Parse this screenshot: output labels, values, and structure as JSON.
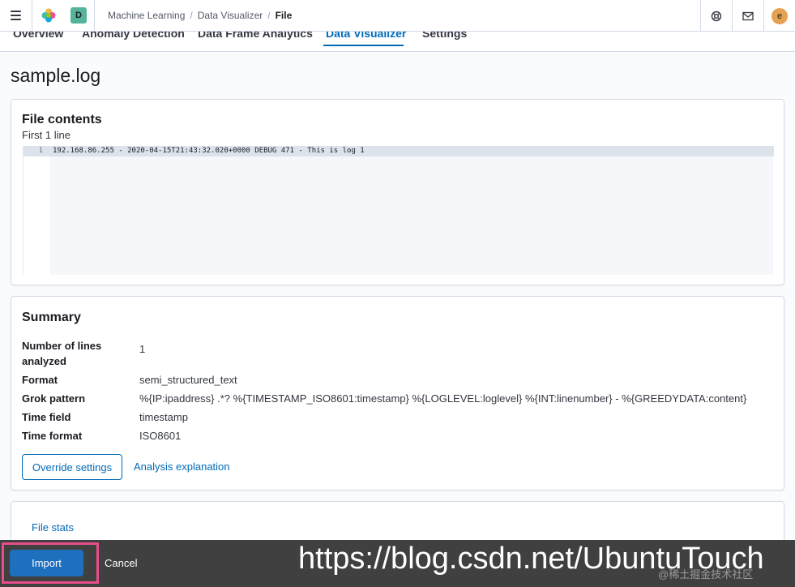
{
  "header": {
    "space_initial": "D",
    "breadcrumbs": [
      "Machine Learning",
      "Data Visualizer",
      "File"
    ],
    "avatar_initial": "e"
  },
  "tabs": [
    {
      "label": "Overview",
      "active": false
    },
    {
      "label": "Anomaly Detection",
      "active": false
    },
    {
      "label": "Data Frame Analytics",
      "active": false
    },
    {
      "label": "Data Visualizer",
      "active": true
    },
    {
      "label": "Settings",
      "active": false
    }
  ],
  "page_title": "sample.log",
  "file_contents": {
    "title": "File contents",
    "subtitle": "First 1 line",
    "lines": [
      {
        "number": "1",
        "text": "192.168.86.255 - 2020-04-15T21:43:32.020+0000 DEBUG 471 - This is log 1"
      }
    ]
  },
  "summary": {
    "title": "Summary",
    "rows": [
      {
        "label": "Number of lines analyzed",
        "value": "1"
      },
      {
        "label": "Format",
        "value": "semi_structured_text"
      },
      {
        "label": "Grok pattern",
        "value": "%{IP:ipaddress} .*? %{TIMESTAMP_ISO8601:timestamp} %{LOGLEVEL:loglevel} %{INT:linenumber} - %{GREEDYDATA:content}"
      },
      {
        "label": "Time field",
        "value": "timestamp"
      },
      {
        "label": "Time format",
        "value": "ISO8601"
      }
    ],
    "override_label": "Override settings",
    "explanation_label": "Analysis explanation"
  },
  "file_stats": {
    "label": "File stats"
  },
  "bottom_bar": {
    "import_label": "Import",
    "cancel_label": "Cancel"
  },
  "watermark": {
    "url": "https://blog.csdn.net/UbuntuTouch",
    "sub": "@稀土掘金技术社区"
  },
  "colors": {
    "accent": "#006bb8",
    "import_button": "#1f6fbf",
    "highlight_outline": "#e84d8a",
    "space_badge": "#54b399",
    "avatar": "#e7a152"
  }
}
